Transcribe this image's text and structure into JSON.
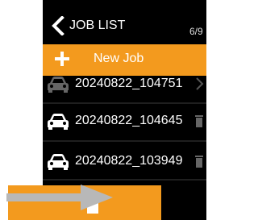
{
  "header": {
    "back_icon": "chevron-left-icon",
    "title": "JOB LIST",
    "page_counter": "6/9"
  },
  "new_job": {
    "icon": "plus-icon",
    "label": "New Job"
  },
  "jobs": [
    {
      "name": "20240822_104751",
      "icon": "car-icon",
      "trailing_icon": "chevron-right-icon"
    },
    {
      "name": "20240822_104645",
      "icon": "car-icon",
      "trailing_icon": "trash-icon"
    },
    {
      "name": "20240822_103949",
      "icon": "car-icon",
      "trailing_icon": "trash-icon"
    }
  ],
  "delete_bar": {
    "icon": "trash-icon"
  },
  "annotation": {
    "icon": "arrow-right-icon"
  },
  "colors": {
    "accent": "#f39a1e",
    "background": "#000000",
    "text": "#ffffff",
    "pointer": "#b8b8b8"
  }
}
